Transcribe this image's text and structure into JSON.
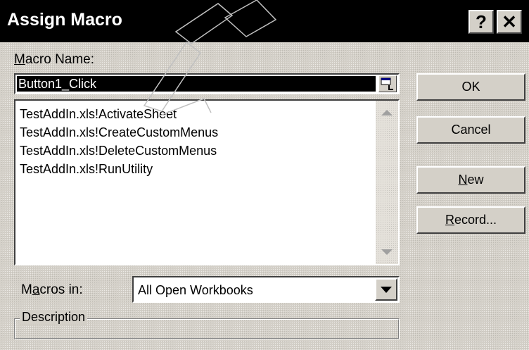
{
  "window": {
    "title": "Assign Macro",
    "help_glyph": "?",
    "close_glyph": "✕"
  },
  "macro_name": {
    "label_key": "M",
    "label_rest": "acro Name:",
    "value": "Button1_Click"
  },
  "macro_list": {
    "items": [
      "TestAddIn.xls!ActivateSheet",
      "TestAddIn.xls!CreateCustomMenus",
      "TestAddIn.xls!DeleteCustomMenus",
      "TestAddIn.xls!RunUtility"
    ]
  },
  "buttons": {
    "ok": "OK",
    "cancel": "Cancel",
    "new_key": "N",
    "new_rest": "ew",
    "record_key": "R",
    "record_rest": "ecord..."
  },
  "macros_in": {
    "label_pre": "M",
    "label_key": "a",
    "label_rest": "cros in:",
    "value": "All Open Workbooks"
  },
  "description": {
    "label": "Description",
    "text": ""
  },
  "colors": {
    "title_bar": "#000000",
    "dialog_face": "#d4d0c8",
    "selection": "#000000"
  }
}
